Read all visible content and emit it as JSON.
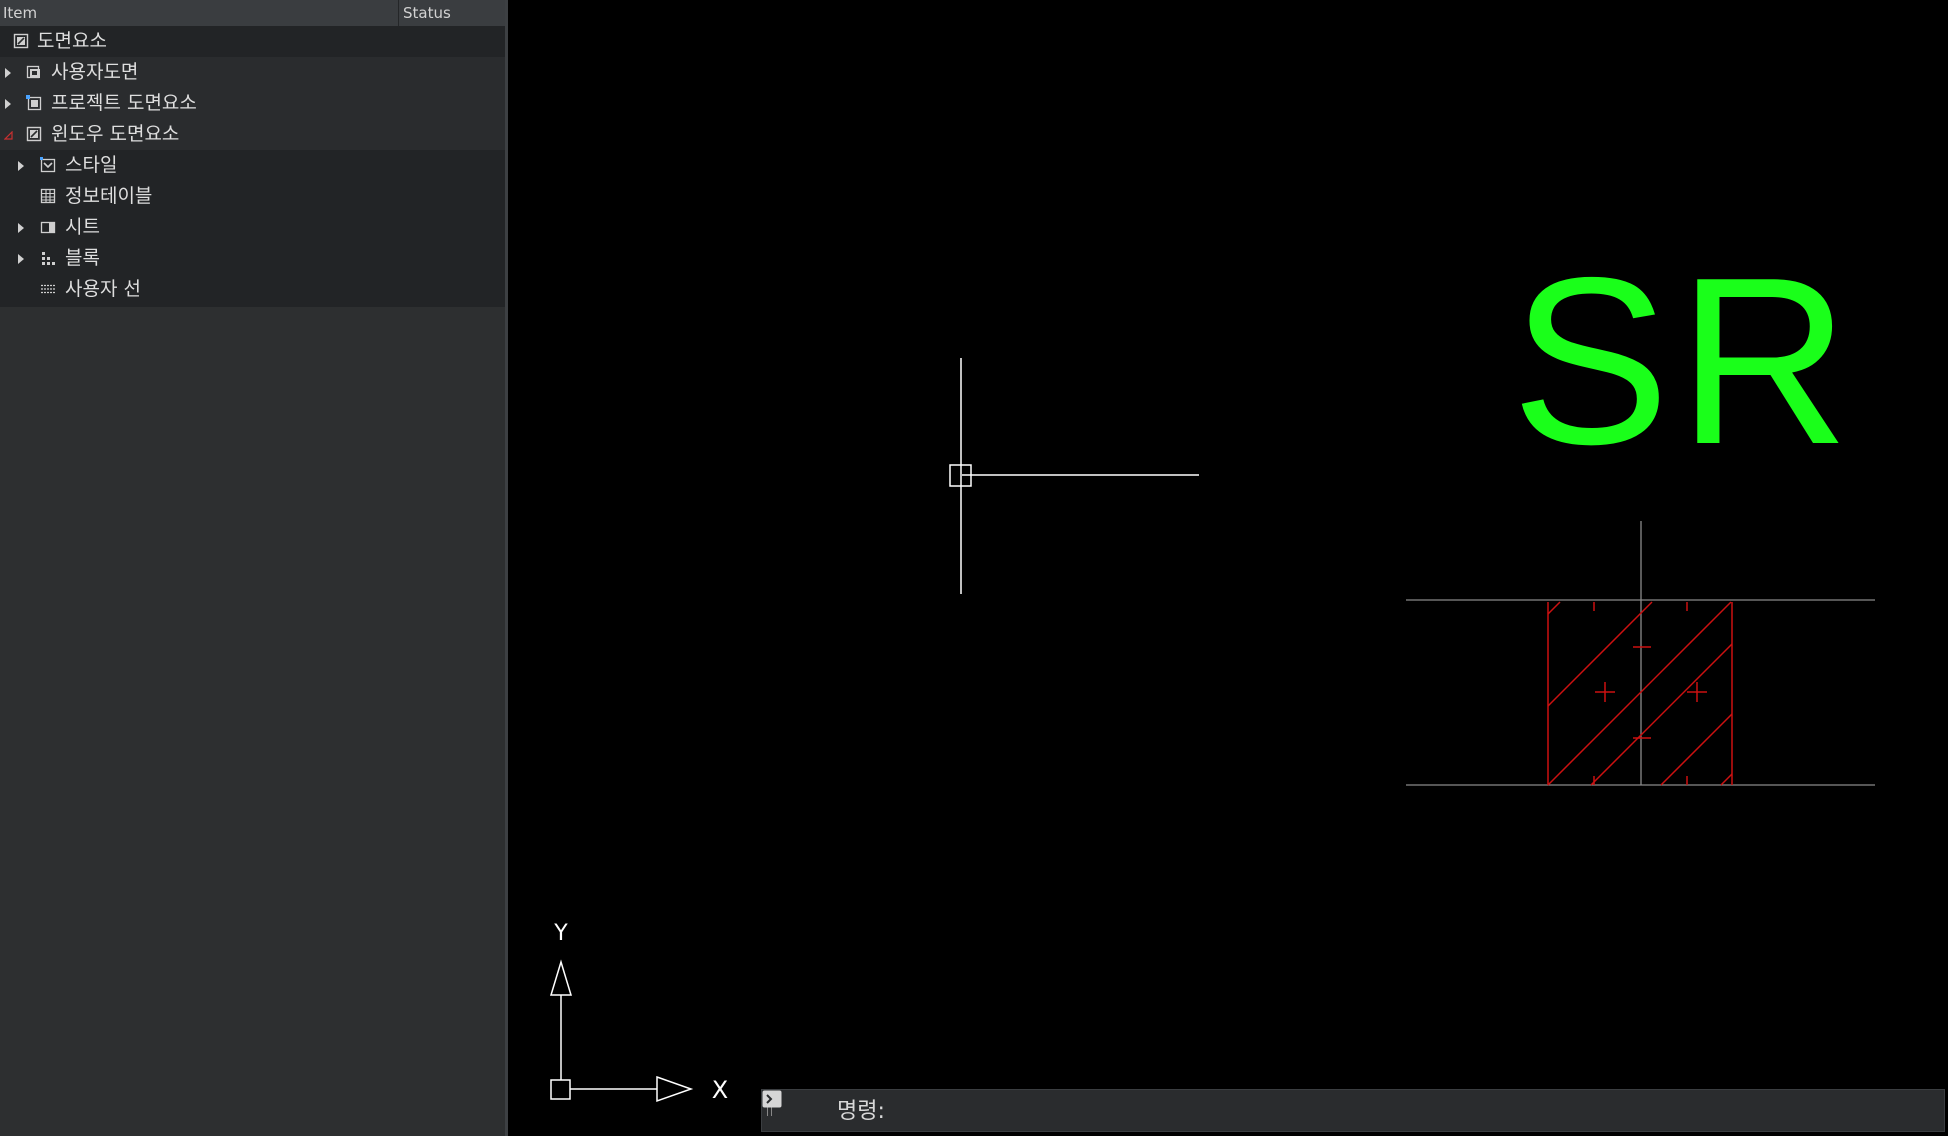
{
  "panel": {
    "header": {
      "item": "Item",
      "status": "Status"
    },
    "rows": [
      {
        "label": "도면요소",
        "icon": "drawing-icon",
        "expander": "none"
      },
      {
        "label": "사용자도면",
        "icon": "user-drawings-icon",
        "expander": "collapsed"
      },
      {
        "label": "프로젝트 도면요소",
        "icon": "project-drawing-icon",
        "expander": "collapsed"
      },
      {
        "label": "윈도우 도면요소",
        "icon": "drawing-icon",
        "expander": "expanded"
      },
      {
        "label": "스타일",
        "icon": "styles-icon",
        "expander": "collapsed"
      },
      {
        "label": "정보테이블",
        "icon": "table-icon",
        "expander": "none"
      },
      {
        "label": "시트",
        "icon": "sheet-icon",
        "expander": "collapsed"
      },
      {
        "label": "블록",
        "icon": "block-icon",
        "expander": "collapsed"
      },
      {
        "label": "사용자 선",
        "icon": "linetype-icon",
        "expander": "none"
      }
    ]
  },
  "canvas": {
    "text": "SR",
    "text_color": "#1aff1a",
    "detail_color": "#cc1111",
    "ucs": {
      "x_label": "X",
      "y_label": "Y"
    }
  },
  "command_line": {
    "prompt": "명령:"
  }
}
